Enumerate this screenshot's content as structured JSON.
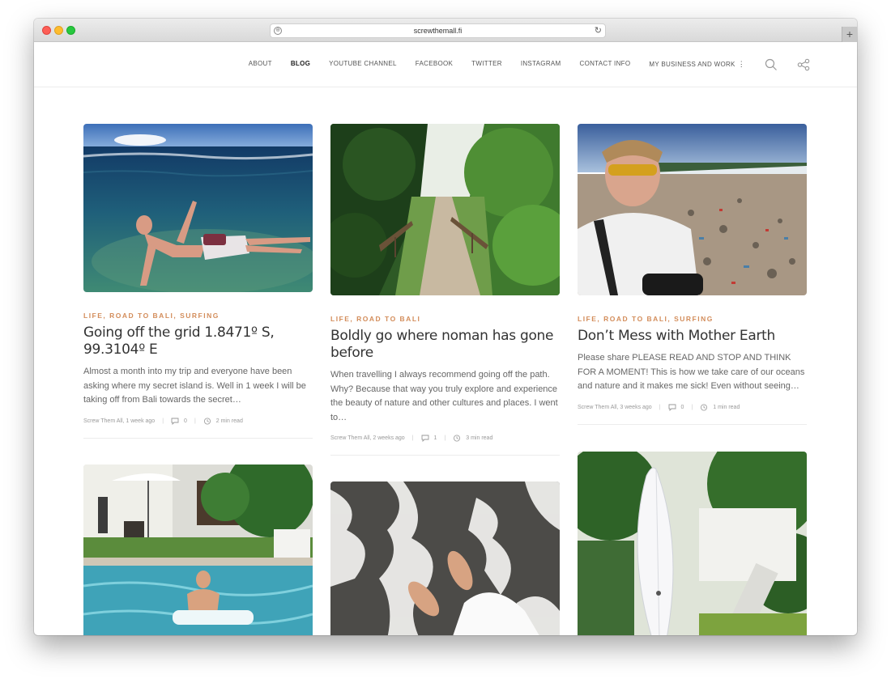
{
  "browser": {
    "url": "screwthemall.fi"
  },
  "nav": {
    "items": [
      "ABOUT",
      "BLOG",
      "YOUTUBE CHANNEL",
      "FACEBOOK",
      "TWITTER",
      "INSTAGRAM",
      "CONTACT INFO",
      "MY BUSINESS AND WORK"
    ],
    "active": "BLOG",
    "more_glyph": "⋮"
  },
  "icons": {
    "search": "search-icon",
    "share": "share-icon"
  },
  "accent_color": "#d38d5b",
  "posts": [
    {
      "categories": "LIFE, ROAD TO BALI, SURFING",
      "title": "Going off the grid 1.8471º S, 99.3104º E",
      "excerpt": "Almost a month into my trip and everyone have been asking where my secret island is. Well in 1 week I will be taking off from Bali towards the secret…",
      "author": "Screw Them All, 1 week ago",
      "comments": "0",
      "read_time": "2 min read"
    },
    {
      "categories": "LIFE, ROAD TO BALI",
      "title": "Boldly go where noman has gone before",
      "excerpt": "When travelling I always recommend going off the path. Why? Because that way you truly explore and experience the beauty of nature and other cultures and places. I went to…",
      "author": "Screw Them All, 2 weeks ago",
      "comments": "1",
      "read_time": "3 min read"
    },
    {
      "categories": "LIFE, ROAD TO BALI, SURFING",
      "title": "Don’t Mess with Mother Earth",
      "excerpt": "Please share PLEASE READ AND STOP AND THINK FOR A MOMENT! This is how we take care of our oceans and nature and it makes me sick! Even without seeing…",
      "author": "Screw Them All, 3 weeks ago",
      "comments": "0",
      "read_time": "1 min read"
    }
  ]
}
